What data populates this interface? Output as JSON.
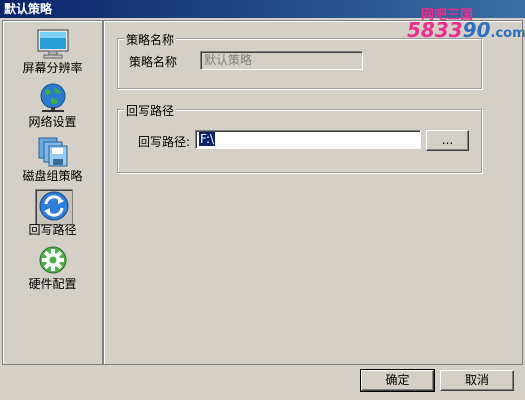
{
  "window": {
    "title": "默认策略"
  },
  "watermark": {
    "line1": "网吧三国",
    "line2_a": "5833",
    "line2_b": "90",
    "line2_c": ".com"
  },
  "sidebar": {
    "items": [
      {
        "label": "屏幕分辨率",
        "icon": "monitor-icon"
      },
      {
        "label": "网络设置",
        "icon": "globe-network-icon"
      },
      {
        "label": "磁盘组策略",
        "icon": "disk-group-icon"
      },
      {
        "label": "回写路径",
        "icon": "writeback-arrows-icon",
        "active": true
      },
      {
        "label": "硬件配置",
        "icon": "hardware-gear-icon"
      }
    ]
  },
  "policy_name": {
    "group_title": "策略名称",
    "label": "策略名称",
    "value": "默认策略"
  },
  "writeback": {
    "group_title": "回写路径",
    "label": "回写路径:",
    "value": "F:\\",
    "browse_label": "..."
  },
  "footer": {
    "ok_label": "确定",
    "cancel_label": "取消"
  }
}
